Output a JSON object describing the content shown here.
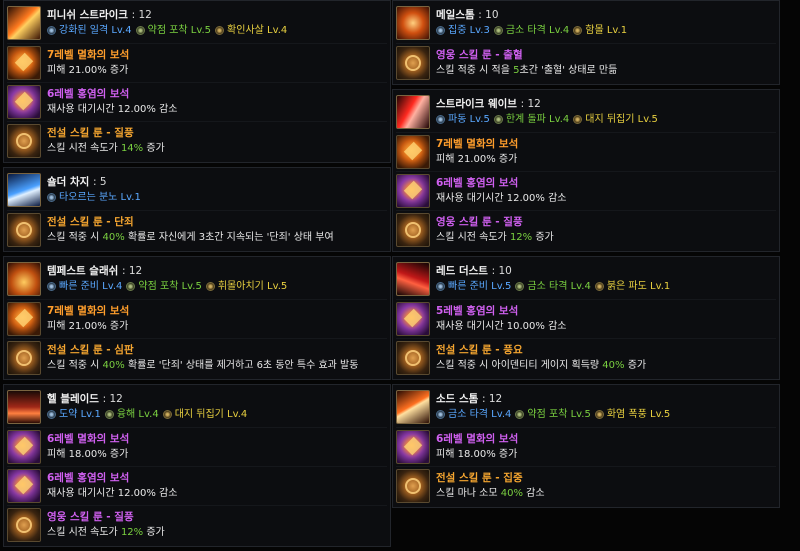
{
  "left": [
    {
      "skill": "피니쉬 스트라이크",
      "level": ": 12",
      "tripods": [
        {
          "text": "강화된 일격 Lv.4",
          "color": "blue"
        },
        {
          "text": "약점 포착 Lv.5",
          "color": "green"
        },
        {
          "text": "확인사살 Lv.4",
          "color": "yellow"
        }
      ],
      "rows": [
        {
          "kind": "gem-orange",
          "label": "7레벨 멸화의 보석",
          "label_color": "orange",
          "desc_pre": "피해 21.00% 증가",
          "desc_hl": "",
          "desc_post": ""
        },
        {
          "kind": "gem-purple",
          "label": "6레벨 홍염의 보석",
          "label_color": "purple",
          "desc_pre": "재사용 대기시간 12.00% 감소",
          "desc_hl": "",
          "desc_post": ""
        },
        {
          "kind": "rune",
          "label": "전설 스킬 룬 - 질풍",
          "label_color": "gold",
          "desc_pre": "스킬 시전 속도가 ",
          "desc_hl": "14%",
          "desc_post": " 증가"
        }
      ]
    },
    {
      "skill": "숄더 차지",
      "level": ": 5",
      "tripods": [
        {
          "text": "타오르는 분노 Lv.1",
          "color": "blue"
        }
      ],
      "rows": [
        {
          "kind": "rune",
          "label": "전설 스킬 룬 - 단죄",
          "label_color": "gold",
          "desc_pre": "스킬 적중 시 ",
          "desc_hl": "40%",
          "desc_post": " 확률로 자신에게 3초간 지속되는 '단죄' 상태 부여"
        }
      ]
    },
    {
      "skill": "템페스트 슬래쉬",
      "level": ": 12",
      "tripods": [
        {
          "text": "빠른 준비 Lv.4",
          "color": "blue"
        },
        {
          "text": "약점 포착 Lv.5",
          "color": "green"
        },
        {
          "text": "휘몰아치기 Lv.5",
          "color": "yellow"
        }
      ],
      "rows": [
        {
          "kind": "gem-orange",
          "label": "7레벨 멸화의 보석",
          "label_color": "orange",
          "desc_pre": "피해 21.00% 증가",
          "desc_hl": "",
          "desc_post": ""
        },
        {
          "kind": "rune",
          "label": "전설 스킬 룬 - 심판",
          "label_color": "gold",
          "desc_pre": "스킬 적중 시 ",
          "desc_hl": "40%",
          "desc_post": " 확률로 '단죄' 상태를 제거하고 6초 동안 특수 효과 발동"
        }
      ]
    },
    {
      "skill": "헬 블레이드",
      "level": ": 12",
      "tripods": [
        {
          "text": "도약 Lv.1",
          "color": "blue"
        },
        {
          "text": "융해 Lv.4",
          "color": "green"
        },
        {
          "text": "대지 뒤집기 Lv.4",
          "color": "yellow"
        }
      ],
      "rows": [
        {
          "kind": "gem-purple",
          "label": "6레벨 멸화의 보석",
          "label_color": "purple",
          "desc_pre": "피해 18.00% 증가",
          "desc_hl": "",
          "desc_post": ""
        },
        {
          "kind": "gem-purple",
          "label": "6레벨 홍염의 보석",
          "label_color": "purple",
          "desc_pre": "재사용 대기시간 12.00% 감소",
          "desc_hl": "",
          "desc_post": ""
        },
        {
          "kind": "rune",
          "label": "영웅 스킬 룬 - 질풍",
          "label_color": "purple",
          "desc_pre": "스킬 시전 속도가 ",
          "desc_hl": "12%",
          "desc_post": " 증가"
        }
      ]
    }
  ],
  "right": [
    {
      "skill": "메일스톰",
      "level": ": 10",
      "tripods": [
        {
          "text": "집중 Lv.3",
          "color": "blue"
        },
        {
          "text": "금소 타격 Lv.4",
          "color": "green"
        },
        {
          "text": "함몰 Lv.1",
          "color": "yellow"
        }
      ],
      "rows": [
        {
          "kind": "rune",
          "label": "영웅 스킬 룬 - 출혈",
          "label_color": "purple",
          "desc_pre": "스킬 적중 시 적을 ",
          "desc_hl": "5",
          "desc_post": "초간 '출혈' 상태로 만듦"
        }
      ]
    },
    {
      "skill": "스트라이크 웨이브",
      "level": ": 12",
      "tripods": [
        {
          "text": "파동 Lv.5",
          "color": "blue"
        },
        {
          "text": "한계 돌파 Lv.4",
          "color": "green"
        },
        {
          "text": "대지 뒤집기 Lv.5",
          "color": "yellow"
        }
      ],
      "rows": [
        {
          "kind": "gem-orange",
          "label": "7레벨 멸화의 보석",
          "label_color": "orange",
          "desc_pre": "피해 21.00% 증가",
          "desc_hl": "",
          "desc_post": ""
        },
        {
          "kind": "gem-purple",
          "label": "6레벨 홍염의 보석",
          "label_color": "purple",
          "desc_pre": "재사용 대기시간 12.00% 감소",
          "desc_hl": "",
          "desc_post": ""
        },
        {
          "kind": "rune",
          "label": "영웅 스킬 룬 - 질풍",
          "label_color": "purple",
          "desc_pre": "스킬 시전 속도가 ",
          "desc_hl": "12%",
          "desc_post": " 증가"
        }
      ]
    },
    {
      "skill": "레드 더스트",
      "level": ": 10",
      "tripods": [
        {
          "text": "빠른 준비 Lv.5",
          "color": "blue"
        },
        {
          "text": "금소 타격 Lv.4",
          "color": "green"
        },
        {
          "text": "붉은 파도 Lv.1",
          "color": "yellow"
        }
      ],
      "rows": [
        {
          "kind": "gem-purple",
          "label": "5레벨 홍염의 보석",
          "label_color": "purple",
          "desc_pre": "재사용 대기시간 10.00% 감소",
          "desc_hl": "",
          "desc_post": ""
        },
        {
          "kind": "rune",
          "label": "전설 스킬 룬 - 풍요",
          "label_color": "gold",
          "desc_pre": "스킬 적중 시 아이덴티티 게이지 획득량 ",
          "desc_hl": "40%",
          "desc_post": " 증가"
        }
      ]
    },
    {
      "skill": "소드 스톰",
      "level": ": 12",
      "tripods": [
        {
          "text": "금소 타격 Lv.4",
          "color": "blue"
        },
        {
          "text": "약점 포착 Lv.5",
          "color": "green"
        },
        {
          "text": "화염 폭풍 Lv.5",
          "color": "yellow"
        }
      ],
      "rows": [
        {
          "kind": "gem-purple",
          "label": "6레벨 멸화의 보석",
          "label_color": "purple",
          "desc_pre": "피해 18.00% 증가",
          "desc_hl": "",
          "desc_post": ""
        },
        {
          "kind": "rune",
          "label": "전설 스킬 룬 - 집중",
          "label_color": "gold",
          "desc_pre": "스킬 마나 소모 ",
          "desc_hl": "40%",
          "desc_post": " 감소"
        }
      ]
    }
  ]
}
